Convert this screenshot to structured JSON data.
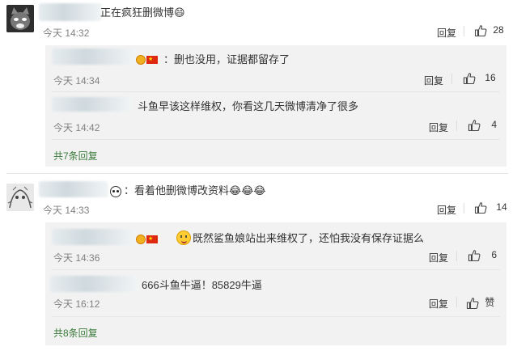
{
  "comments": [
    {
      "text": "正在疯狂删微博😄",
      "time": "今天 14:32",
      "reply_label": "回复",
      "likes": "28",
      "replies": [
        {
          "text": "：删也没用，证据都留存了",
          "time": "今天 14:34",
          "reply_label": "回复",
          "likes": "16"
        },
        {
          "text": "斗鱼早该这样维权，你看这几天微博清净了很多",
          "time": "今天 14:42",
          "reply_label": "回复",
          "likes": "4"
        }
      ],
      "more": "共7条回复"
    },
    {
      "text": "：看着他删微博改资料😂😂😂",
      "time": "今天 14:33",
      "reply_label": "回复",
      "likes": "14",
      "replies": [
        {
          "text": "既然鲨鱼娘站出来维权了，还怕我没有保存证据么",
          "time": "今天 14:36",
          "reply_label": "回复",
          "likes": "6"
        },
        {
          "text": "666斗鱼牛逼！85829牛逼",
          "time": "今天 16:12",
          "reply_label": "回复",
          "likes": "赞"
        }
      ],
      "more": "共8条回复"
    }
  ],
  "colors": {
    "accent": "#3a7a3a",
    "muted": "#808080",
    "reply_bg": "#f2f2f2"
  },
  "icons": {
    "like": "thumbs-up-icon",
    "panda": "panda-emoji-icon"
  }
}
